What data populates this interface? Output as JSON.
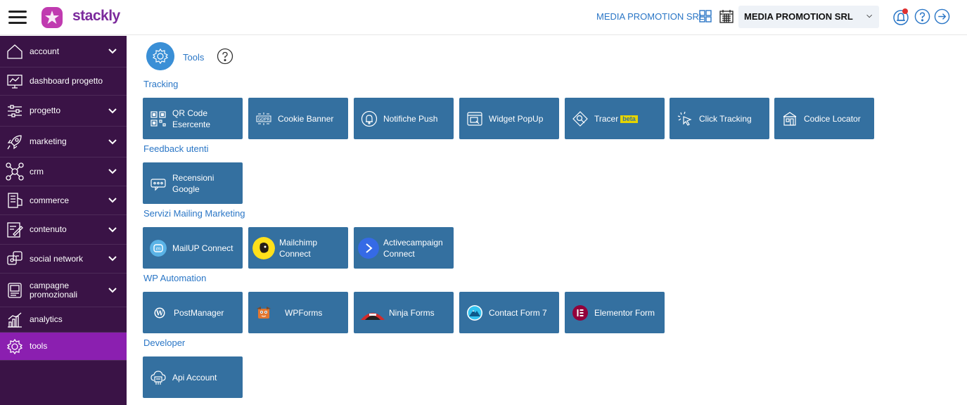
{
  "header": {
    "logo_text": "stackly",
    "company_label": "MEDIA PROMOTION SRL",
    "company_select_value": "MEDIA PROMOTION SRL"
  },
  "sidebar": {
    "items": [
      {
        "label": "account",
        "icon": "home-icon"
      },
      {
        "label": "dashboard progetto",
        "icon": "dashboard-icon"
      },
      {
        "label": "progetto",
        "icon": "sliders-icon"
      },
      {
        "label": "marketing",
        "icon": "rocket-icon"
      },
      {
        "label": "crm",
        "icon": "network-icon"
      },
      {
        "label": "commerce",
        "icon": "store-icon"
      },
      {
        "label": "contenuto",
        "icon": "edit-icon"
      },
      {
        "label": "social network",
        "icon": "social-icon"
      },
      {
        "label": "campagne promozionali",
        "icon": "adv-icon"
      },
      {
        "label": "analytics",
        "icon": "analytics-icon"
      },
      {
        "label": "tools",
        "icon": "gear-icon"
      }
    ]
  },
  "main": {
    "title": "Tools",
    "sections": [
      {
        "title": "Tracking",
        "tiles": [
          {
            "label": "QR Code Esercente",
            "icon": "qr-code-icon"
          },
          {
            "label": "Cookie Banner",
            "icon": "gdpr-icon"
          },
          {
            "label": "Notifiche Push",
            "icon": "bell-icon"
          },
          {
            "label": "Widget PopUp",
            "icon": "popup-icon"
          },
          {
            "label": "Tracer",
            "badge": "beta",
            "icon": "tracer-icon"
          },
          {
            "label": "Click Tracking",
            "icon": "click-icon"
          },
          {
            "label": "Codice Locator",
            "icon": "locator-icon"
          }
        ]
      },
      {
        "title": "Feedback utenti",
        "tiles": [
          {
            "label": "Recensioni Google",
            "icon": "review-icon"
          }
        ]
      },
      {
        "title": "Servizi Mailing Marketing",
        "tiles": [
          {
            "label": "MailUP Connect",
            "icon": "mailup-icon"
          },
          {
            "label": "Mailchimp Connect",
            "icon": "mailchimp-icon"
          },
          {
            "label": "Activecampaign Connect",
            "icon": "activecampaign-icon"
          }
        ]
      },
      {
        "title": "WP Automation",
        "tiles": [
          {
            "label": "PostManager",
            "icon": "wordpress-icon"
          },
          {
            "label": "WPForms",
            "icon": "wpforms-icon"
          },
          {
            "label": "Ninja Forms",
            "icon": "ninja-forms-icon"
          },
          {
            "label": "Contact Form 7",
            "icon": "contact-form-7-icon"
          },
          {
            "label": "Elementor Form",
            "icon": "elementor-icon"
          }
        ]
      },
      {
        "title": "Developer",
        "tiles": [
          {
            "label": "Api Account",
            "icon": "api-icon"
          }
        ]
      }
    ]
  },
  "colors": {
    "sidebar_bg": "#3a1346",
    "sidebar_active": "#8b1fb0",
    "tile_bg": "#3470a0",
    "accent_blue": "#2a76c6",
    "brand_purple": "#7b2a9c"
  }
}
